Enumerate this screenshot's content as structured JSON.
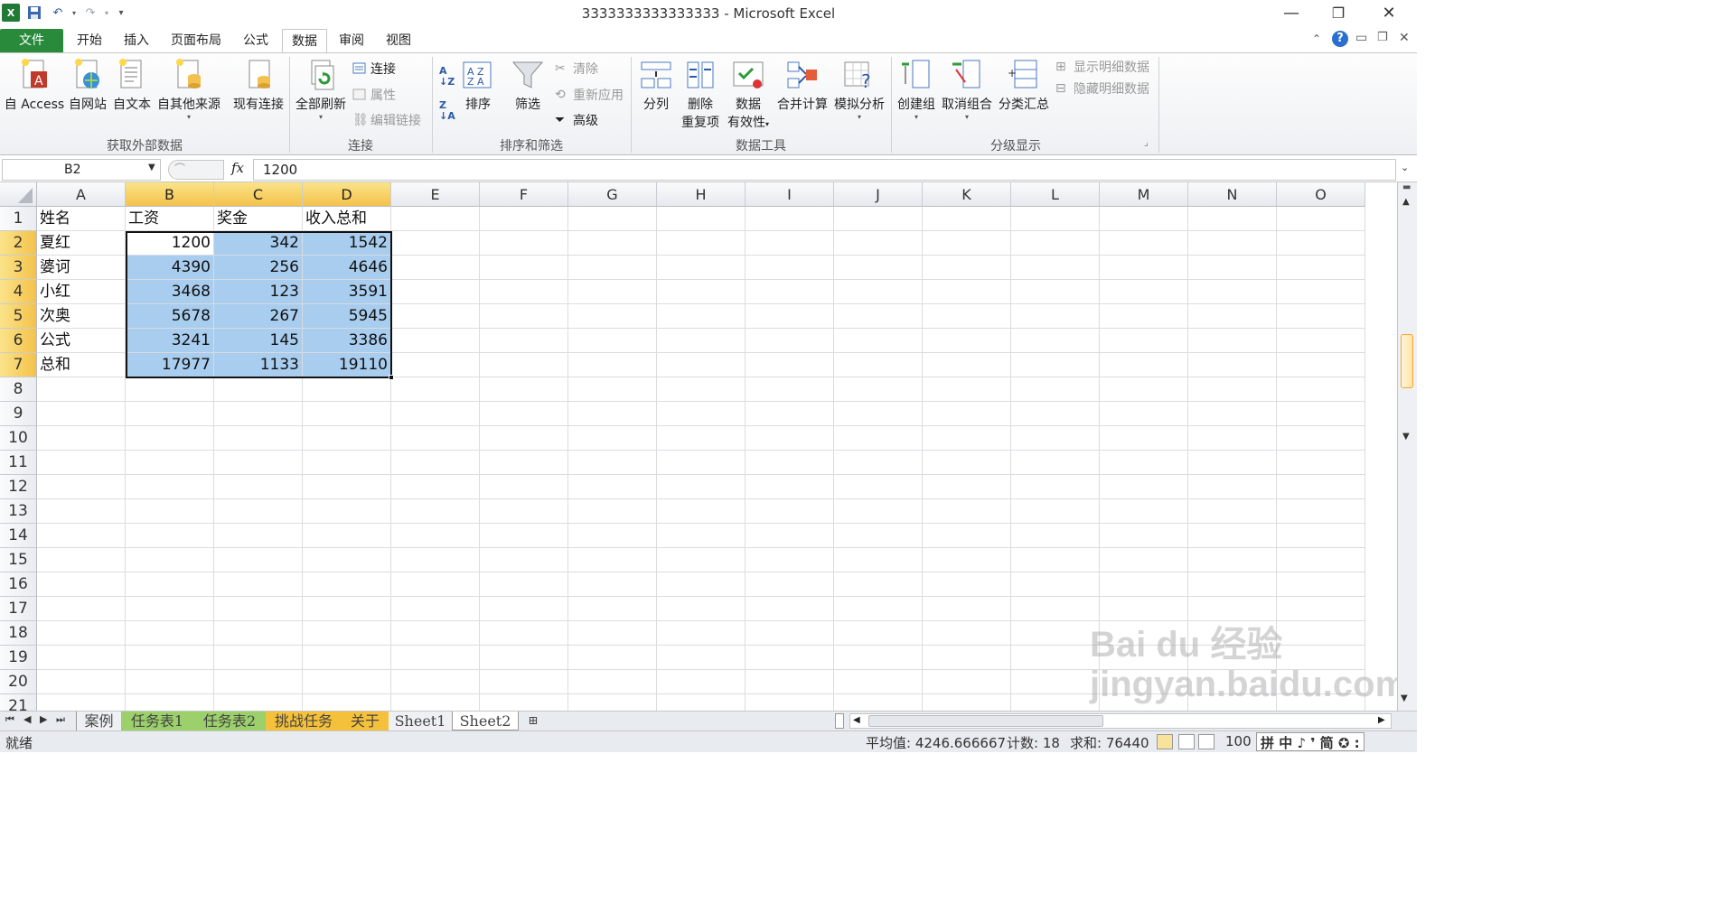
{
  "window": {
    "title": "3333333333333333 - Microsoft Excel",
    "controls": {
      "minimize": "—",
      "restore": "❐",
      "close": "✕"
    }
  },
  "tabs": [
    "文件",
    "开始",
    "插入",
    "页面布局",
    "公式",
    "数据",
    "审阅",
    "视图"
  ],
  "ribbon": {
    "get_external": {
      "label": "获取外部数据",
      "buttons": [
        "自 Access",
        "自网站",
        "自文本",
        "自其他来源"
      ]
    },
    "existing_conn": "现有连接",
    "connections": {
      "label": "连接",
      "refresh_all": "全部刷新",
      "conn": "连接",
      "properties": "属性",
      "edit_links": "编辑链接"
    },
    "sort_filter": {
      "label": "排序和筛选",
      "sort": "排序",
      "filter": "筛选",
      "clear": "清除",
      "reapply": "重新应用",
      "advanced": "高级"
    },
    "data_tools": {
      "label": "数据工具",
      "split": "分列",
      "remove_dup_1": "删除",
      "remove_dup_2": "重复项",
      "validation_1": "数据",
      "validation_2": "有效性",
      "consolidate": "合并计算",
      "whatif": "模拟分析"
    },
    "outline": {
      "label": "分级显示",
      "group": "创建组",
      "ungroup": "取消组合",
      "subtotal": "分类汇总",
      "show_detail": "显示明细数据",
      "hide_detail": "隐藏明细数据"
    }
  },
  "formula_bar": {
    "name_box": "B2",
    "fx": "fx",
    "value": "1200"
  },
  "columns": [
    "A",
    "B",
    "C",
    "D",
    "E",
    "F",
    "G",
    "H",
    "I",
    "J",
    "K",
    "L",
    "M",
    "N",
    "O"
  ],
  "rows": [
    "1",
    "2",
    "3",
    "4",
    "5",
    "6",
    "7",
    "8",
    "9",
    "10",
    "11",
    "12",
    "13",
    "14",
    "15",
    "16",
    "17",
    "18",
    "19",
    "20",
    "21"
  ],
  "cells": {
    "A1": "姓名",
    "B1": "工资",
    "C1": "奖金",
    "D1": "收入总和",
    "A2": "夏红",
    "B2": "1200",
    "C2": "342",
    "D2": "1542",
    "A3": "婆诃",
    "B3": "4390",
    "C3": "256",
    "D3": "4646",
    "A4": "小红",
    "B4": "3468",
    "C4": "123",
    "D4": "3591",
    "A5": "次奥",
    "B5": "5678",
    "C5": "267",
    "D5": "5945",
    "A6": "公式",
    "B6": "3241",
    "C6": "145",
    "D6": "3386",
    "A7": "总和",
    "B7": "17977",
    "C7": "1133",
    "D7": "19110"
  },
  "sheets": [
    "案例",
    "任务表1",
    "任务表2",
    "挑战任务",
    "关于",
    "Sheet1",
    "Sheet2"
  ],
  "status": {
    "ready": "就绪",
    "average": "平均值: 4246.666667",
    "count": "计数: 18",
    "sum": "求和: 76440",
    "zoom": "100",
    "ime": "拼 中 ♪ ❜ 简 ✪ :"
  },
  "watermark": "Bai du 经验 jingyan.baidu.com"
}
